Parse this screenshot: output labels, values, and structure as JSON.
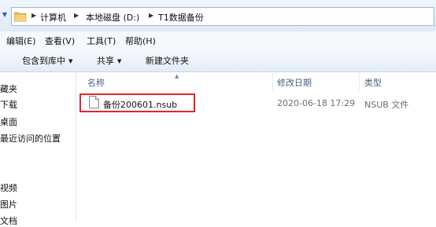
{
  "address": {
    "crumbs": [
      "计算机",
      "本地磁盘 (D:)",
      "T1数据备份"
    ]
  },
  "menu": [
    "编辑(E)",
    "查看(V)",
    "工具(T)",
    "帮助(H)"
  ],
  "commands": [
    {
      "label": "包含到库中",
      "dropdown": true
    },
    {
      "label": "共享",
      "dropdown": true
    },
    {
      "label": "新建文件夹",
      "dropdown": false
    }
  ],
  "nav": [
    "藏夹",
    "下载",
    "桌面",
    "最近访问的位置",
    "视频",
    "图片",
    "文档"
  ],
  "columns": {
    "name": "名称",
    "modified": "修改日期",
    "type": "类型"
  },
  "files": [
    {
      "name": "备份200601.nsub",
      "modified": "2020-06-18 17:29",
      "type": "NSUB 文件"
    }
  ],
  "colors": {
    "highlight": "#e0272b",
    "accent": "#2b5d9a"
  },
  "icons": [
    "folder-icon",
    "chevron-down-icon",
    "breadcrumb-arrow-icon",
    "sort-arrow-icon",
    "document-icon"
  ]
}
